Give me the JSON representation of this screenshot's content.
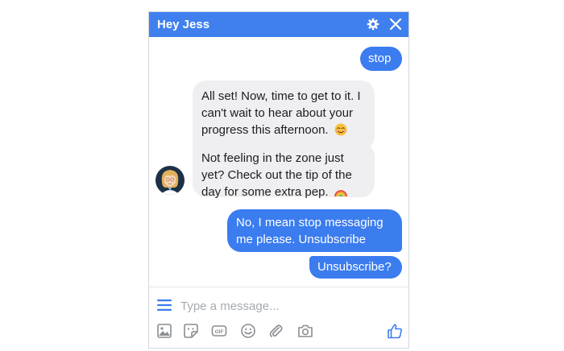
{
  "header": {
    "title": "Hey Jess",
    "accent_color": "#4080ee",
    "icons": [
      "gear-icon",
      "close-icon"
    ]
  },
  "messages": [
    {
      "from": "user",
      "text": "stop"
    },
    {
      "from": "bot",
      "text": "All set! Now, time to get to it. I can't wait to hear about your progress this afternoon.",
      "emoji": "smiling-face-emoji"
    },
    {
      "from": "bot",
      "text": "Not feeling in the zone just yet? Check out the tip of the day for some extra pep.",
      "emoji": "rainbow-emoji"
    },
    {
      "from": "user",
      "text": "No, I mean stop messaging me please. Unsubscribe"
    },
    {
      "from": "user",
      "text": "Unsubscribe?"
    }
  ],
  "composer": {
    "placeholder": "Type a message...",
    "value": "",
    "toolbar_icons": [
      "photo-icon",
      "sticker-icon",
      "gif-icon",
      "emoji-icon",
      "attachment-icon",
      "camera-icon",
      "like-icon"
    ]
  }
}
